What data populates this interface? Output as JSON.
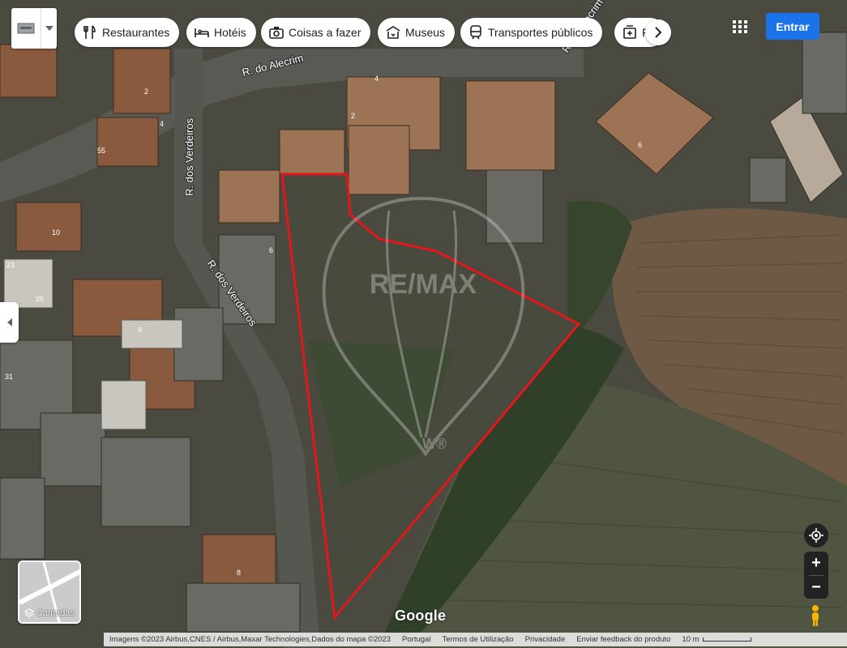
{
  "chips": [
    {
      "label": "Restaurantes",
      "icon": "fork-knife-icon"
    },
    {
      "label": "Hotéis",
      "icon": "bed-icon"
    },
    {
      "label": "Coisas a fazer",
      "icon": "camera-icon"
    },
    {
      "label": "Museus",
      "icon": "museum-icon"
    },
    {
      "label": "Transportes públicos",
      "icon": "train-icon"
    },
    {
      "label": "F",
      "icon": "pharmacy-icon"
    }
  ],
  "signin_label": "Entrar",
  "layers_label": "Camadas",
  "streets": [
    "R. do Alecrim",
    "R. dos Verdeiros",
    "R. dos Verdeiros",
    "R. do Alecrim"
  ],
  "parcel_numbers": [
    "2",
    "4",
    "4",
    "2",
    "55",
    "10",
    "6",
    "23",
    "25",
    "9",
    "31",
    "6",
    "8"
  ],
  "watermark": {
    "brand": "RE/MAX",
    "mark": "W®"
  },
  "google_logo": "Google",
  "footer": {
    "imagery": "Imagens ©2023 Airbus,CNES / Airbus,Maxar Technologies,Dados do mapa ©2023",
    "country": "Portugal",
    "terms": "Termos de Utilização",
    "privacy": "Privacidade",
    "feedback": "Enviar feedback do produto",
    "scale": "10 m"
  },
  "colors": {
    "boundary": "#e3161c",
    "signin": "#1a73e8"
  }
}
